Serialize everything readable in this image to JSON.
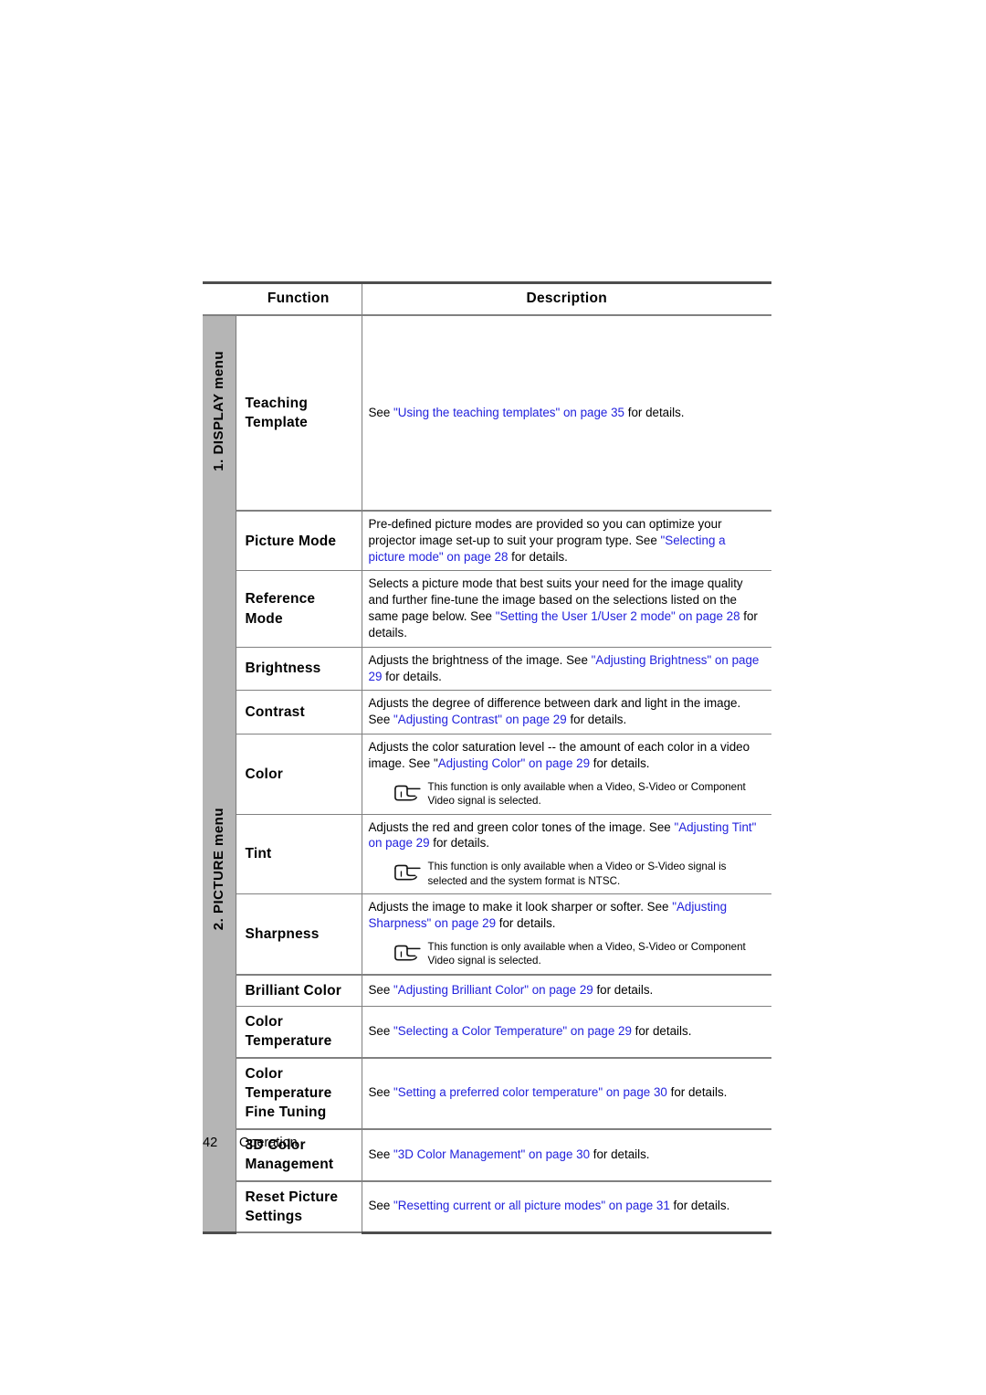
{
  "page": {
    "footer_page_number": "42",
    "footer_section": "Operation"
  },
  "table": {
    "headers": {
      "function": "Function",
      "description": "Description"
    },
    "menu_groups": [
      {
        "label": "1. DISPLAY menu"
      },
      {
        "label": "2. PICTURE menu"
      }
    ],
    "rows": [
      {
        "function": "Teaching Template",
        "function_lines": [
          "Teaching",
          "Template"
        ],
        "description_plain": "See \"Using the teaching templates\" on page 35 for details.",
        "segments": [
          {
            "text": "See ",
            "link": false
          },
          {
            "text": "\"Using the teaching templates\" on page 35",
            "link": true
          },
          {
            "text": " for details.",
            "link": false
          }
        ],
        "note": null
      },
      {
        "function": "Picture Mode",
        "function_lines": [
          "Picture Mode"
        ],
        "description_plain": "Pre-defined picture modes are provided so you can optimize your projector image set-up to suit your program type. See \"Selecting a picture mode\" on page 28 for details.",
        "segments": [
          {
            "text": "Pre-defined picture modes are provided so you can optimize your projector image set-up to suit your program type. See ",
            "link": false
          },
          {
            "text": "\"Selecting a picture mode\" on page 28",
            "link": true
          },
          {
            "text": " for details.",
            "link": false
          }
        ],
        "note": null
      },
      {
        "function": "Reference Mode",
        "function_lines": [
          "Reference",
          "Mode"
        ],
        "description_plain": "Selects a picture mode that best suits your need for the image quality and further fine-tune the image based on the selections listed on the same page below. See \"Setting the User 1/User 2 mode\" on page 28 for details.",
        "segments": [
          {
            "text": "Selects a picture mode that best suits your need for the image quality and further fine-tune the image based on the selections listed on the same page below. See ",
            "link": false
          },
          {
            "text": "\"Setting the User 1/User 2 mode\" on page 28",
            "link": true
          },
          {
            "text": " for details.",
            "link": false
          }
        ],
        "note": null
      },
      {
        "function": "Brightness",
        "function_lines": [
          "Brightness"
        ],
        "description_plain": "Adjusts the brightness of the image. See \"Adjusting Brightness\" on page 29 for details.",
        "segments": [
          {
            "text": "Adjusts the brightness of the image. See ",
            "link": false
          },
          {
            "text": "\"Adjusting Brightness\" on page 29",
            "link": true
          },
          {
            "text": " for details.",
            "link": false
          }
        ],
        "note": null
      },
      {
        "function": "Contrast",
        "function_lines": [
          "Contrast"
        ],
        "description_plain": "Adjusts the degree of difference between dark and light in the image. See \"Adjusting Contrast\" on page 29 for details.",
        "segments": [
          {
            "text": "Adjusts the degree of difference between dark and light in the image. See ",
            "link": false
          },
          {
            "text": "\"Adjusting Contrast\" on page 29",
            "link": true
          },
          {
            "text": " for details.",
            "link": false
          }
        ],
        "note": null
      },
      {
        "function": "Color",
        "function_lines": [
          "Color"
        ],
        "description_plain": "Adjusts the color saturation level -- the amount of each color in a video image. See \"Adjusting Color\" on page 29 for details.",
        "segments": [
          {
            "text": "Adjusts the color saturation level -- the amount of each color in a video image. See \"",
            "link": false
          },
          {
            "text": "Adjusting Color\" on page 29",
            "link": true
          },
          {
            "text": " for details.",
            "link": false
          }
        ],
        "note": "This function is only available when a Video, S-Video or Component Video signal is selected."
      },
      {
        "function": "Tint",
        "function_lines": [
          "Tint"
        ],
        "description_plain": "Adjusts the red and green color tones of the image. See \"Adjusting Tint\" on page 29 for details.",
        "segments": [
          {
            "text": "Adjusts the red and green color tones of the image. See ",
            "link": false
          },
          {
            "text": "\"Adjusting Tint\" on page 29",
            "link": true
          },
          {
            "text": " for details.",
            "link": false
          }
        ],
        "note": "This function is only available when a Video or S-Video signal is selected and the system format is NTSC."
      },
      {
        "function": "Sharpness",
        "function_lines": [
          "Sharpness"
        ],
        "description_plain": "Adjusts the image to make it look sharper or softer. See \"Adjusting Sharpness\" on page 29 for details.",
        "segments": [
          {
            "text": "Adjusts the image to make it look sharper or softer. See ",
            "link": false
          },
          {
            "text": "\"Adjusting Sharpness\" on page 29",
            "link": true
          },
          {
            "text": " for details.",
            "link": false
          }
        ],
        "note": "This function is only available when a Video, S-Video or Component Video signal is selected."
      },
      {
        "function": "Brilliant Color",
        "function_lines": [
          "Brilliant Color"
        ],
        "description_plain": "See \"Adjusting Brilliant Color\" on page 29 for details.",
        "segments": [
          {
            "text": "See ",
            "link": false
          },
          {
            "text": "\"Adjusting Brilliant Color\" on page 29",
            "link": true
          },
          {
            "text": " for details.",
            "link": false
          }
        ],
        "note": null
      },
      {
        "function": "Color Temperature",
        "function_lines": [
          "Color",
          "Temperature"
        ],
        "description_plain": "See \"Selecting a Color Temperature\" on page 29 for details.",
        "segments": [
          {
            "text": "See ",
            "link": false
          },
          {
            "text": "\"Selecting a Color Temperature\" on page 29",
            "link": true
          },
          {
            "text": " for details.",
            "link": false
          }
        ],
        "note": null
      },
      {
        "function": "Color Temperature Fine Tuning",
        "function_lines": [
          "Color",
          "Temperature",
          "Fine Tuning"
        ],
        "description_plain": "See \"Setting a preferred color temperature\" on page 30 for details.",
        "segments": [
          {
            "text": "See ",
            "link": false
          },
          {
            "text": "\"Setting a preferred color temperature\" on page 30",
            "link": true
          },
          {
            "text": " for details.",
            "link": false
          }
        ],
        "note": null
      },
      {
        "function": "3D Color Management",
        "function_lines": [
          "3D Color",
          "Management"
        ],
        "description_plain": "See \"3D Color Management\" on page 30 for details.",
        "segments": [
          {
            "text": "See ",
            "link": false
          },
          {
            "text": "\"3D Color Management\" on page 30",
            "link": true
          },
          {
            "text": " for details.",
            "link": false
          }
        ],
        "note": null
      },
      {
        "function": "Reset Picture Settings",
        "function_lines": [
          "Reset Picture",
          "Settings"
        ],
        "description_plain": "See \"Resetting current or all picture modes\" on page 31 for details.",
        "segments": [
          {
            "text": "See ",
            "link": false
          },
          {
            "text": "\"Resetting current or all picture modes\" on page 31",
            "link": true
          },
          {
            "text": " for details.",
            "link": false
          }
        ],
        "note": null
      }
    ]
  },
  "icons": {
    "note": "pointing-hand-icon"
  },
  "colors": {
    "link": "#2222dd",
    "strip_background": "#b5b5b5",
    "rule_light": "#808080",
    "rule_heavy": "#4d4d4d",
    "text": "#000000"
  }
}
